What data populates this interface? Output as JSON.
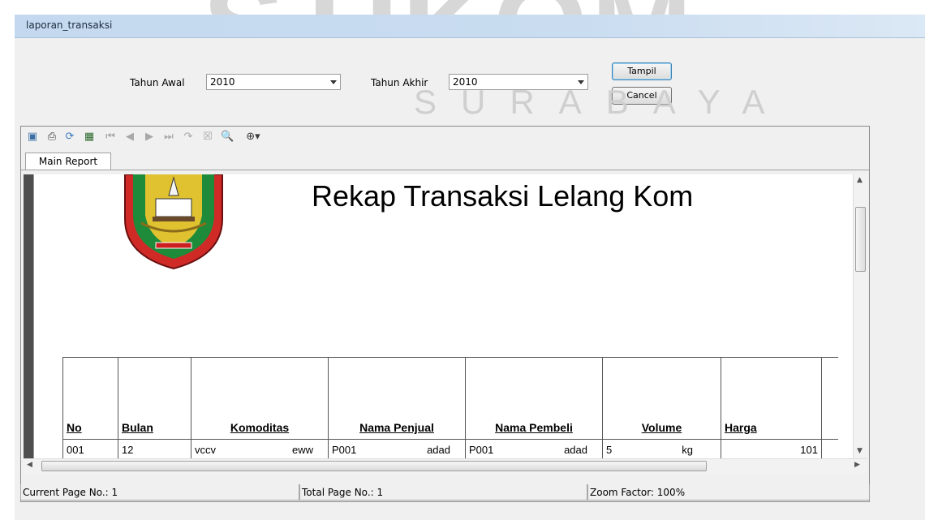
{
  "watermark": {
    "top": "STIKOM",
    "bottom": "SURABAYA"
  },
  "window": {
    "title": "laporan_transaksi"
  },
  "filters": {
    "tahun_awal_label": "Tahun Awal",
    "tahun_awal_value": "2010",
    "tahun_akhir_label": "Tahun Akhir",
    "tahun_akhir_value": "2010"
  },
  "buttons": {
    "tampil": "Tampil",
    "cancel": "Cancel"
  },
  "viewer": {
    "toolbar_icons": [
      "export-icon",
      "print-icon",
      "refresh-icon",
      "group-tree-icon",
      "first-page-icon",
      "prev-page-icon",
      "next-page-icon",
      "last-page-icon",
      "goto-page-icon",
      "close-view-icon",
      "search-icon",
      "zoom-icon"
    ],
    "tab_label": "Main Report"
  },
  "report": {
    "title": "Rekap Transaksi Lelang Kom",
    "headers": [
      "No",
      "Bulan",
      "Komoditas",
      "Nama Penjual",
      "Nama Pembeli",
      "Volume",
      "Harga"
    ],
    "rows": [
      {
        "no": "001",
        "bulan": "12",
        "komoditas_a": "vccv",
        "komoditas_b": "eww",
        "penjual_a": "P001",
        "penjual_b": "adad",
        "pembeli_a": "P001",
        "pembeli_b": "adad",
        "volume": "5",
        "unit": "kg",
        "harga": "101"
      }
    ]
  },
  "status": {
    "current_page": "Current Page No.: 1",
    "total_page": "Total Page No.: 1",
    "zoom": "Zoom Factor: 100%"
  },
  "colors": {
    "titlebar": "#c9dcf0",
    "report_leftbar": "#4e4e4e",
    "emblem_red": "#d02a27",
    "emblem_green": "#1e8b3a"
  }
}
